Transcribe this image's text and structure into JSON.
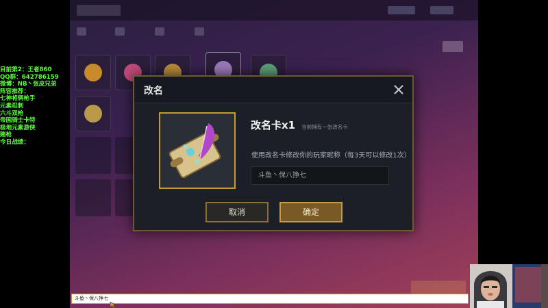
{
  "stream_overlay": {
    "lines": [
      "目前第2：王者860",
      "QQ群：642786159",
      "微博：NB丶张皮兄弟",
      "阵容推荐：",
      "七神将俩枪手",
      "元素忍刺",
      "六斗双枪",
      "帝国骑士卡特",
      "极地元素游侠",
      "赌枪",
      "今日战绩："
    ]
  },
  "modal": {
    "title": "改名",
    "card_name": "改名卡x1",
    "card_owned_text": "当前拥有一张改名卡",
    "description": "使用改名卡修改你的玩家昵称（每3天可以修改1次）",
    "input_value": "斗鱼丶保八挣七",
    "cancel_label": "取消",
    "confirm_label": "确定"
  },
  "chat_bar": {
    "text": "斗鱼丶保八挣七"
  },
  "colors": {
    "overlay_text": "#5cff3c",
    "modal_border": "#6b5a35",
    "card_frame": "#c69a30",
    "confirm_button": "#7a5a24"
  },
  "icons": {
    "close": "close-icon",
    "card": "scroll-quill-icon"
  }
}
